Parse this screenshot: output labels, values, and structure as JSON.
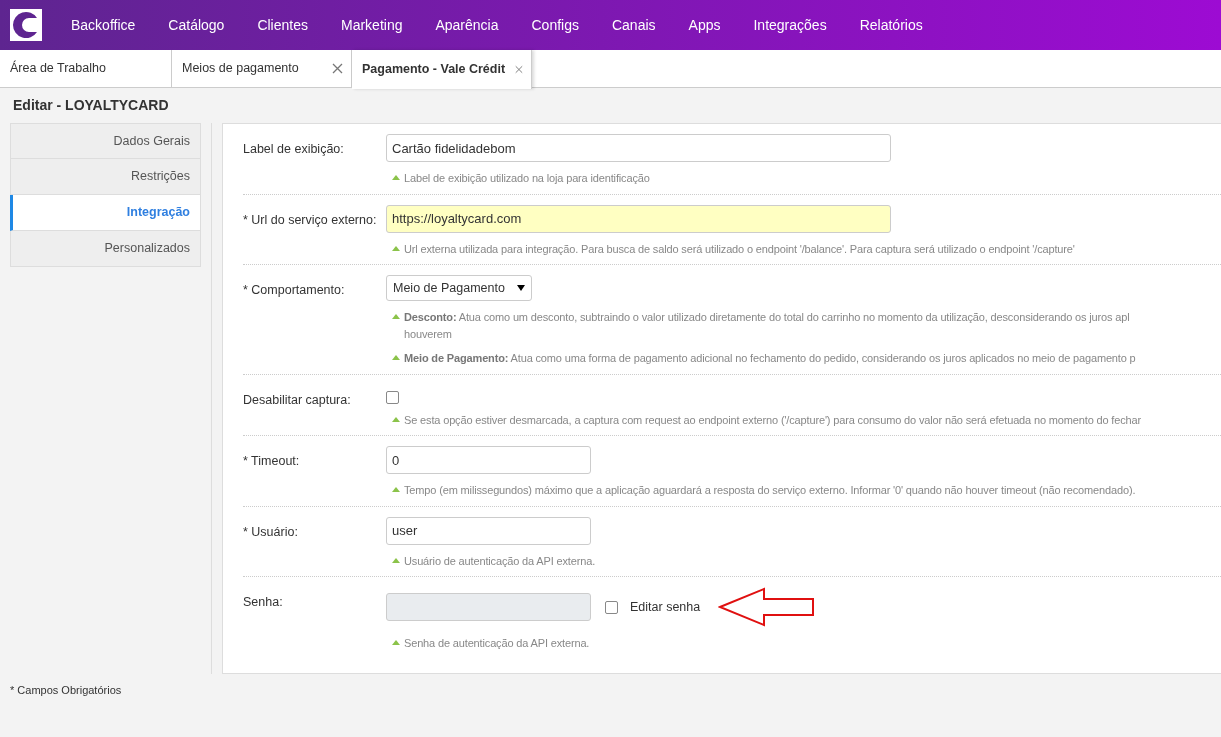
{
  "nav": {
    "items": [
      "Backoffice",
      "Catálogo",
      "Clientes",
      "Marketing",
      "Aparência",
      "Configs",
      "Canais",
      "Apps",
      "Integrações",
      "Relatórios"
    ]
  },
  "tabs": [
    {
      "label": "Área de Trabalho",
      "selected": false,
      "closable": false
    },
    {
      "label": "Meios de pagamento",
      "selected": false,
      "closable": true
    },
    {
      "label": "Pagamento - Vale Crédit",
      "selected": true,
      "closable": true
    }
  ],
  "page_title": "Editar - LOYALTYCARD",
  "sidebar": {
    "items": [
      {
        "label": "Dados Gerais",
        "selected": false
      },
      {
        "label": "Restrições",
        "selected": false
      },
      {
        "label": "Integração",
        "selected": true
      },
      {
        "label": "Personalizados",
        "selected": false
      }
    ]
  },
  "form": {
    "rows": [
      {
        "kind": "text",
        "label": "Label de exibição:",
        "value": "Cartão fidelidadebom",
        "highlighted": false,
        "wide": true,
        "help": [
          [
            "Label de exibição utilizado na loja para identificação"
          ]
        ]
      },
      {
        "kind": "text",
        "label": "* Url do serviço externo:",
        "value": "https://loyaltycard.com",
        "highlighted": true,
        "wide": true,
        "help": [
          [
            "Url externa utilizada para integração. Para busca de saldo será utilizado o endpoint '/balance'. Para captura será utilizado o endpoint '/capture'"
          ]
        ]
      },
      {
        "kind": "select",
        "label": "* Comportamento:",
        "value": "Meio de Pagamento",
        "help": [
          [
            "**Desconto:**  Atua como um desconto, subtraindo o valor utilizado diretamente do total do carrinho no momento da utilização, desconsiderando os juros apl",
            "houverem"
          ],
          [
            "**Meio de Pagamento:**  Atua como uma forma de pagamento adicional no fechamento do pedido, considerando os juros aplicados no meio de pagamento p"
          ]
        ]
      },
      {
        "kind": "checkbox",
        "label": "Desabilitar captura:",
        "checked": false,
        "help": [
          [
            "Se esta opção estiver desmarcada, a captura com request ao endpoint externo ('/capture') para consumo do valor não será efetuada no momento do fechar"
          ]
        ]
      },
      {
        "kind": "text",
        "label": "* Timeout:",
        "value": "0",
        "highlighted": false,
        "wide": false,
        "help": [
          [
            "Tempo (em milissegundos) máximo que a aplicação aguardará a resposta do serviço externo. Informar '0' quando não houver timeout (não recomendado)."
          ]
        ]
      },
      {
        "kind": "text",
        "label": "* Usuário:",
        "value": "user",
        "highlighted": false,
        "wide": false,
        "help": [
          [
            "Usuário de autenticação da API externa."
          ]
        ]
      },
      {
        "kind": "password",
        "label": "Senha:",
        "disabled": true,
        "edit_label": "Editar senha",
        "edit_checked": false,
        "help": [
          [
            "Senha de autenticação da API externa."
          ]
        ]
      }
    ]
  },
  "footer_note": "* Campos Obrigatórios"
}
